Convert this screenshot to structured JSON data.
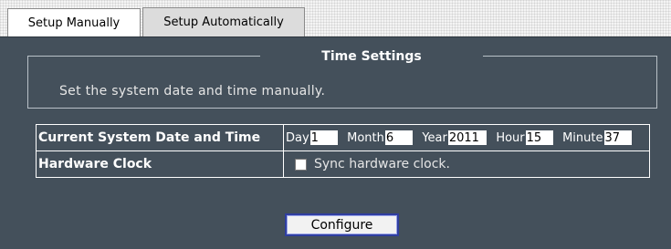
{
  "tabs": [
    {
      "label": "Setup Manually",
      "active": true
    },
    {
      "label": "Setup Automatically",
      "active": false
    }
  ],
  "group": {
    "title": "Time Settings",
    "description": "Set the system date and time manually."
  },
  "rows": {
    "datetime": {
      "label": "Current System Date and Time",
      "fields": [
        {
          "label": "Day",
          "value": "1"
        },
        {
          "label": "Month",
          "value": "6"
        },
        {
          "label": "Year",
          "value": "2011"
        },
        {
          "label": "Hour",
          "value": "15"
        },
        {
          "label": "Minute",
          "value": "37"
        }
      ]
    },
    "hwclock": {
      "label": "Hardware Clock",
      "checkbox_label": "Sync hardware clock.",
      "checked": false
    }
  },
  "configure_label": "Configure",
  "colors": {
    "panel": "#44505b",
    "button_border": "#2f3ea0"
  }
}
